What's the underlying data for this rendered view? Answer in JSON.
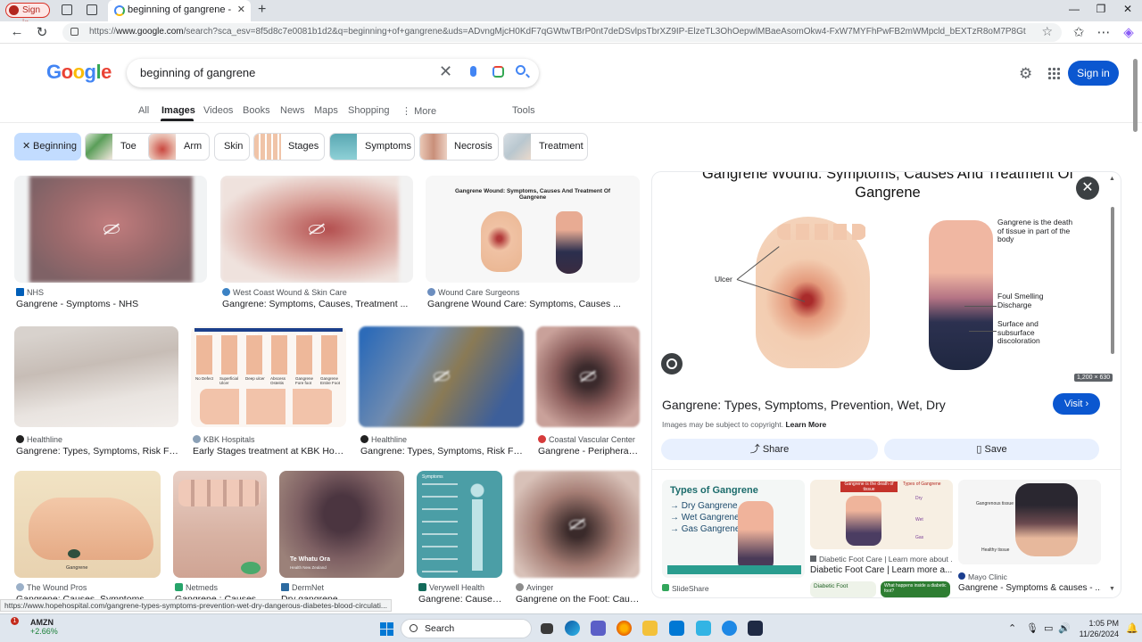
{
  "browser": {
    "signin_pill": "Sign in",
    "tab_title": "beginning of gangrene - Google S",
    "url_prefix": "https://",
    "url_domain": "www.google.com",
    "url_rest": "/search?sca_esv=8f5d8c7e0081b1d2&q=beginning+of+gangrene&uds=ADvngMjcH0KdF7qGWtwTBrP0nt7deDSvlpsTbrXZ9IP-ElzeTL3OhOepwlMBaeAsomOkw4-FxW7MYFhPwFB2mWMpcld_bEXTzR8oM7P8Gt-YfKL-cGMQTjyzesrp..."
  },
  "header": {
    "logo_letters": [
      "G",
      "o",
      "o",
      "g",
      "l",
      "e"
    ],
    "query": "beginning of gangrene",
    "signin_label": "Sign in"
  },
  "tabs": {
    "all": "All",
    "images": "Images",
    "videos": "Videos",
    "books": "Books",
    "news": "News",
    "maps": "Maps",
    "shopping": "Shopping",
    "more": "More",
    "tools": "Tools"
  },
  "chips": {
    "beginning": "Beginning",
    "toe": "Toe",
    "arm": "Arm",
    "skin": "Skin",
    "stages": "Stages",
    "symptoms": "Symptoms",
    "necrosis": "Necrosis",
    "treatment": "Treatment"
  },
  "results": [
    {
      "source": "NHS",
      "caption": "Gangrene - Symptoms - NHS"
    },
    {
      "source": "West Coast Wound & Skin Care",
      "caption": "Gangrene: Symptoms, Causes, Treatment ..."
    },
    {
      "source": "Wound Care Surgeons",
      "caption": "Gangrene Wound Care: Symptoms, Causes ..."
    },
    {
      "source": "Healthline",
      "caption": "Gangrene: Types, Symptoms, Risk Facto..."
    },
    {
      "source": "KBK Hospitals",
      "caption": "Early Stages treatment at KBK Hospita..."
    },
    {
      "source": "Healthline",
      "caption": "Gangrene: Types, Symptoms, Risk Factor..."
    },
    {
      "source": "Coastal Vascular Center",
      "caption": "Gangrene - Peripheral A..."
    },
    {
      "source": "The Wound Pros",
      "caption": "Gangrene: Causes, Symptoms, and ..."
    },
    {
      "source": "Netmeds",
      "caption": "Gangrene : Causes, S..."
    },
    {
      "source": "DermNet",
      "caption": "Dry gangrene ..."
    },
    {
      "source": "Verywell Health",
      "caption": "Gangrene: Causes, ..."
    },
    {
      "source": "Avinger",
      "caption": "Gangrene on the Foot: Causes..."
    }
  ],
  "thumb_texts": {
    "r3_title": "Gangrene Wound: Symptoms, Causes And Treatment Of Gangrene",
    "r5_stages": [
      "Stage",
      "Stage",
      "Stage",
      "Stage",
      "Stage",
      "Stage"
    ],
    "r5_labels": [
      "No Defect",
      "Superficial Ulcer",
      "Deep ulcer",
      "Abscess Osteitis",
      "Gangrene Fore foot",
      "Gangrene Entire Foot"
    ],
    "r8_label": "Gangrene",
    "r10_brand": "Te Whatu Ora",
    "r10_sub": "Health New Zealand",
    "r11_title": "Symptoms"
  },
  "panel": {
    "image_title": "Gangrene Wound: Symptoms, Causes And Treatment Of Gangrene",
    "label_ulcer": "Ulcer",
    "label_death": "Gangrene is the death of tissue in part of the body",
    "label_foul": "Foul Smelling Discharge",
    "label_surface": "Surface and subsurface discoloration",
    "dimensions": "1,200 × 630",
    "title": "Gangrene: Types, Symptoms, Prevention, Wet, Dry",
    "visit_label": "Visit",
    "copyright": "Images may be subject to copyright.",
    "learn_more": "Learn More",
    "share_label": "Share",
    "save_label": "Save",
    "related": [
      {
        "source": "SlideShare",
        "caption": "",
        "img_lines": [
          "Types of Gangrene",
          "Dry Gangrene",
          "Wet Gangrene",
          "Gas Gangrene"
        ]
      },
      {
        "source": "Diabetic Foot Care | Learn more about ...",
        "caption": "Diabetic Foot Care | Learn more a...",
        "img_lines": [
          "Gangrene is the death of tissue",
          "Types of Gangrene",
          "Dry",
          "Wet",
          "Gas"
        ]
      },
      {
        "source": "Mayo Clinic",
        "caption": "Gangrene - Symptoms & causes - ...",
        "img_lines": [
          "Gangrenous tissue",
          "Healthy tissue"
        ]
      }
    ],
    "related_extra": [
      "Diabetic Foot",
      "What happens inside a diabetic foot?"
    ]
  },
  "statusbar": "https://www.hopehospital.com/gangrene-types-symptoms-prevention-wet-dry-dangerous-diabetes-blood-circulati...",
  "taskbar": {
    "stock_badge": "1",
    "stock_symbol": "AMZN",
    "stock_change": "+2.66%",
    "search_label": "Search",
    "time": "1:05 PM",
    "date": "11/26/2024"
  }
}
